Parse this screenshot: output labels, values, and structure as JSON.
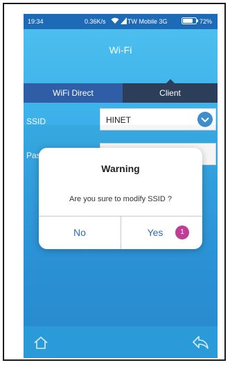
{
  "status_bar": {
    "time": "19:34",
    "data_rate": "0.36K/s",
    "carrier": "TW Mobile 3G",
    "battery": "72%"
  },
  "app": {
    "title": "Wi-Fi"
  },
  "tabs": [
    {
      "label": "WiFi Direct",
      "selected": false
    },
    {
      "label": "Client",
      "selected": true
    }
  ],
  "form": {
    "ssid_label": "SSID",
    "ssid_value": "HINET",
    "password_label": "Password",
    "password_value": ""
  },
  "dialog": {
    "title": "Warning",
    "message": "Are you sure to modify SSID ?",
    "no_label": "No",
    "yes_label": "Yes",
    "badge": "1"
  },
  "icons": {
    "home": "home-icon",
    "back": "back-icon",
    "chevron": "chevron-down-icon",
    "wifi": "wifi-icon",
    "signal": "signal-icon",
    "battery": "battery-icon"
  },
  "colors": {
    "status_bar": "#1d6bb6",
    "tab_selected": "#2d3e5a",
    "tab_unselected": "#2f5ea6",
    "dialog_button_text": "#2b6bb7",
    "badge": "#bf3d96"
  }
}
